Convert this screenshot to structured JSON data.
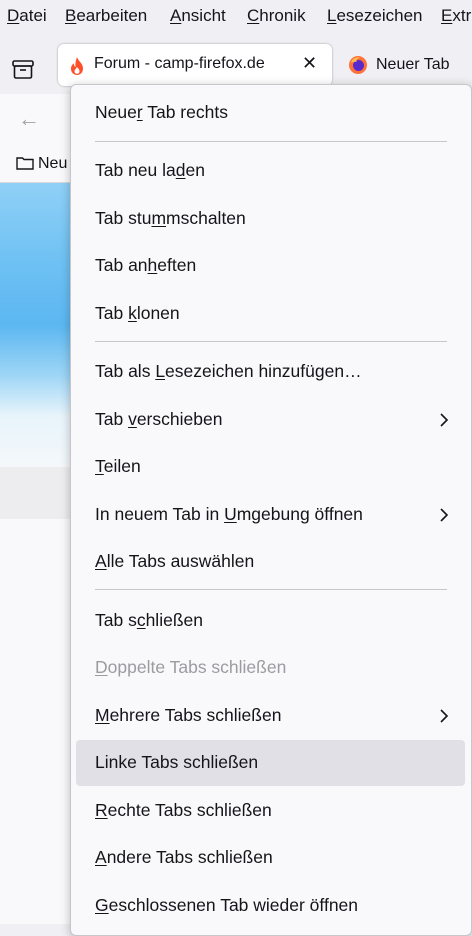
{
  "menubar": [
    {
      "pre": "",
      "acc": "D",
      "post": "atei"
    },
    {
      "pre": "",
      "acc": "B",
      "post": "earbeiten"
    },
    {
      "pre": "",
      "acc": "A",
      "post": "nsicht"
    },
    {
      "pre": "",
      "acc": "C",
      "post": "hronik"
    },
    {
      "pre": "",
      "acc": "L",
      "post": "esezeichen"
    },
    {
      "pre": "",
      "acc": "E",
      "post": "xtr"
    }
  ],
  "tabs": {
    "active_title": "Forum - camp-firefox.de",
    "close_glyph": "✕",
    "second_title": "Neuer Tab"
  },
  "bookmarks": {
    "first_label": "Neu"
  },
  "context_menu": {
    "items": [
      {
        "pre": "Neue",
        "acc": "r",
        "post": " Tab rechts"
      },
      {
        "pre": "Tab neu la",
        "acc": "d",
        "post": "en"
      },
      {
        "pre": "Tab stu",
        "acc": "m",
        "post": "mschalten"
      },
      {
        "pre": "Tab an",
        "acc": "h",
        "post": "eften"
      },
      {
        "pre": "Tab ",
        "acc": "k",
        "post": "lonen"
      },
      {
        "pre": "Tab als ",
        "acc": "L",
        "post": "esezeichen hinzufügen…"
      },
      {
        "pre": "Tab ",
        "acc": "v",
        "post": "erschieben"
      },
      {
        "pre": "",
        "acc": "T",
        "post": "eilen"
      },
      {
        "pre": "In neuem Tab in ",
        "acc": "U",
        "post": "mgebung öffnen"
      },
      {
        "pre": "",
        "acc": "A",
        "post": "lle Tabs auswählen"
      },
      {
        "pre": "Tab s",
        "acc": "c",
        "post": "hließen"
      },
      {
        "pre": "",
        "acc": "D",
        "post": "oppelte Tabs schließen"
      },
      {
        "pre": "",
        "acc": "M",
        "post": "ehrere Tabs schließen"
      },
      {
        "pre": "Linke Tabs schließen",
        "acc": "",
        "post": ""
      },
      {
        "pre": "",
        "acc": "R",
        "post": "echte Tabs schließen"
      },
      {
        "pre": "",
        "acc": "A",
        "post": "ndere Tabs schließen"
      },
      {
        "pre": "",
        "acc": "G",
        "post": "eschlossenen Tab wieder öffnen"
      }
    ]
  },
  "colors": {
    "accent_firefox_flame": "#ff4f2a",
    "hover_item": "#e0e0e6",
    "disabled_text": "#9b9ba1"
  }
}
